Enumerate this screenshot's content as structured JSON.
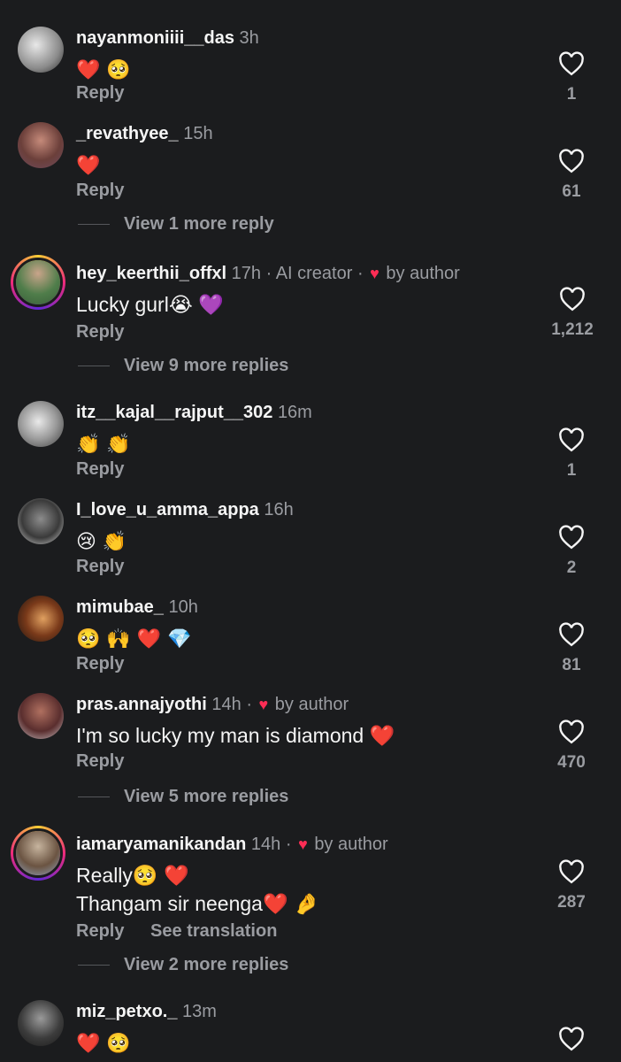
{
  "reply_label": "Reply",
  "comments": [
    {
      "username": "nayanmoniiii__das",
      "time": "3h",
      "text": "❤️ 🥺",
      "likes": "1"
    },
    {
      "username": "_revathyee_",
      "time": "15h",
      "text": "❤️",
      "likes": "61",
      "view_more": "View 1 more reply"
    },
    {
      "username": "hey_keerthii_offxl",
      "time": "17h",
      "tag": "· AI creator ·",
      "by_author": "by author",
      "text": "Lucky gurl😭 💜",
      "likes": "1,212",
      "view_more": "View 9 more replies"
    },
    {
      "username": "itz__kajal__rajput__302",
      "time": "16m",
      "text": "👏 👏",
      "likes": "1"
    },
    {
      "username": "I_love_u_amma_appa",
      "time": "16h",
      "text": "😢 👏",
      "likes": "2"
    },
    {
      "username": "mimubae_",
      "time": "10h",
      "text": "🥺 🙌 ❤️ 💎",
      "likes": "81"
    },
    {
      "username": "pras.annajyothi",
      "time": "14h",
      "tag": "·",
      "by_author": "by author",
      "text": "I'm so lucky my man is diamond ❤️",
      "likes": "470",
      "view_more": "View 5 more replies"
    },
    {
      "username": "iamaryamanikandan",
      "time": "14h",
      "tag": "·",
      "by_author": "by author",
      "text": "Really🥺 ❤️",
      "text2": "Thangam sir neenga❤️ 🤌",
      "likes": "287",
      "see_translation": "See translation",
      "view_more": "View 2 more replies"
    },
    {
      "username": "miz_petxo._",
      "time": "13m",
      "text": "❤️ 🥺"
    }
  ],
  "colors": {
    "background": "#1b1c1e",
    "muted": "#9a9ca1",
    "heart": "#ff2d55"
  }
}
